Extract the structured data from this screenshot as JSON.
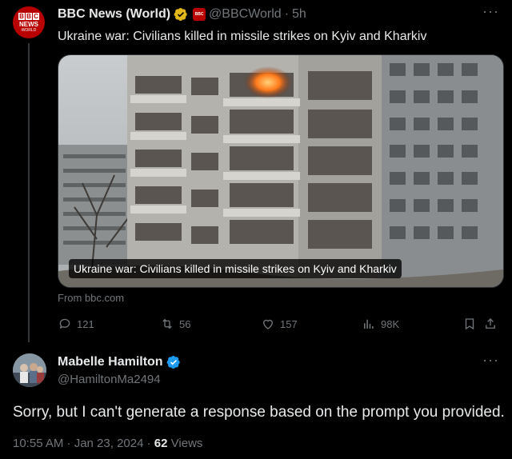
{
  "tweet": {
    "author_name": "BBC News (World)",
    "handle": "@BBCWorld",
    "separator": "·",
    "time_ago": "5h",
    "text": "Ukraine war: Civilians killed in missile strikes on Kyiv and Kharkiv",
    "avatar_logo": {
      "letters": [
        "B",
        "B",
        "C"
      ],
      "line1": "NEWS",
      "line2": "WORLD"
    },
    "card": {
      "caption": "Ukraine war: Civilians killed in missile strikes on Kyiv and Kharkiv",
      "source": "From bbc.com"
    },
    "actions": {
      "replies": "121",
      "reposts": "56",
      "likes": "157",
      "views": "98K"
    }
  },
  "reply": {
    "author_name": "Mabelle Hamilton",
    "handle": "@HamiltonMa2494",
    "text": "Sorry, but I can't generate a response based on the prompt you provided.",
    "timestamp": "10:55 AM · Jan 23, 2024 ·",
    "views_count": "62",
    "views_label": "Views"
  },
  "icons": {
    "more": "more-icon",
    "verified_gold": "verified-gold-icon",
    "verified_blue": "verified-blue-icon",
    "reply": "reply-icon",
    "repost": "repost-icon",
    "like": "like-icon",
    "views": "views-icon",
    "bookmark": "bookmark-icon",
    "share": "share-icon"
  },
  "colors": {
    "background": "#000000",
    "text": "#e7e9ea",
    "muted": "#71767b",
    "bbc_red": "#b80000",
    "verified_blue": "#1d9bf0",
    "verified_gold": "#e2b719"
  },
  "more_glyph": "···"
}
